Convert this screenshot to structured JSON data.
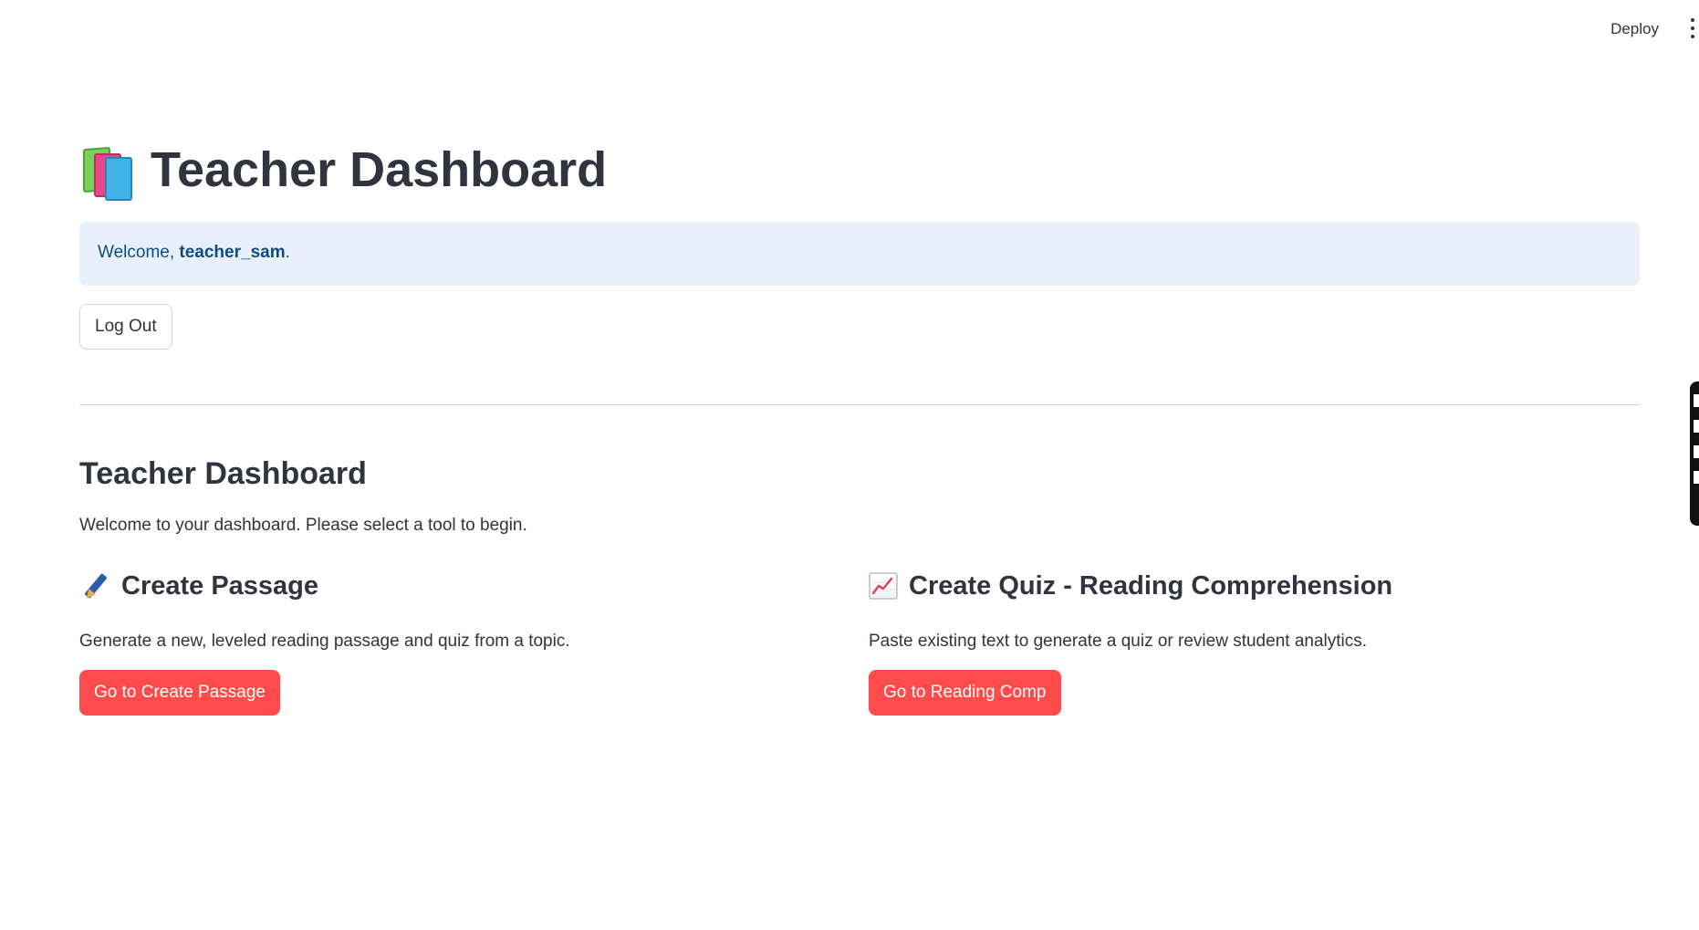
{
  "topbar": {
    "deploy_label": "Deploy",
    "menu_icon": "kebab-vertical-icon"
  },
  "header": {
    "icon": "books-icon",
    "title": "Teacher Dashboard"
  },
  "info": {
    "prefix": "Welcome, ",
    "username": "teacher_sam",
    "suffix": "."
  },
  "logout": {
    "label": "Log Out"
  },
  "section": {
    "title": "Teacher Dashboard",
    "description": "Welcome to your dashboard. Please select a tool to begin."
  },
  "tools": [
    {
      "icon": "pen-icon",
      "title": "Create Passage",
      "description": "Generate a new, leveled reading passage and quiz from a topic.",
      "button": "Go to Create Passage"
    },
    {
      "icon": "chart-increasing-icon",
      "title": "Create Quiz - Reading Comprehension",
      "description": "Paste existing text to generate a quiz or review student analytics.",
      "button": "Go to Reading Comp"
    }
  ],
  "colors": {
    "primary_button": "#ff4b4b",
    "info_background": "#e8f1fb",
    "info_text": "#0f4c81",
    "text": "#31333f"
  }
}
